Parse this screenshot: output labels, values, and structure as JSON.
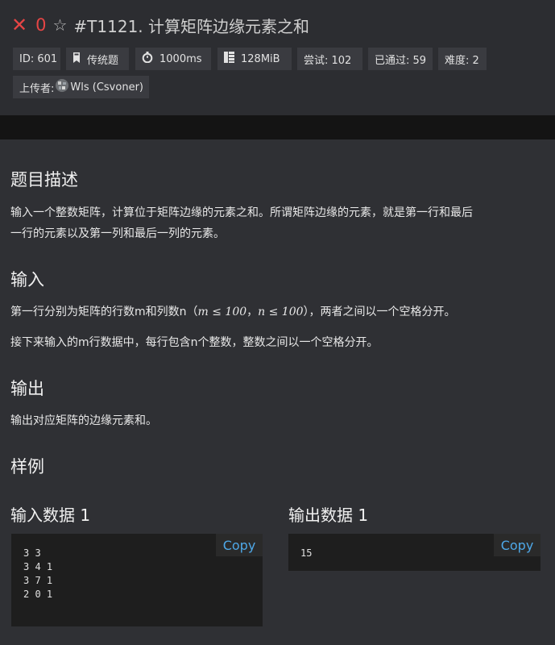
{
  "header": {
    "status_icon": "x-icon",
    "score": "0",
    "star_icon": "star-icon",
    "title": "#T1121. 计算矩阵边缘元素之和",
    "tags": {
      "id": "ID: 601",
      "type": "传统题",
      "time": "1000ms",
      "memory": "128MiB",
      "tries": "尝试: 102",
      "passed": "已通过: 59",
      "difficulty": "难度: 2",
      "uploader_label": "上传者:",
      "uploader_name": "Wls (Csvoner)"
    }
  },
  "sections": {
    "description_title": "题目描述",
    "description_line1": "输入一个整数矩阵，计算位于矩阵边缘的元素之和。所谓矩阵边缘的元素，就是第一行和最后",
    "description_line2": "一行的元素以及第一列和最后一列的元素。",
    "input_title": "输入",
    "input_p1_a": "第一行分别为矩阵的行数m和列数n（",
    "input_p1_math1": "m ≤ 100",
    "input_p1_sep": "，",
    "input_p1_math2": "n ≤ 100",
    "input_p1_b": "），两者之间以一个空格分开。",
    "input_p2": "接下来输入的m行数据中，每行包含n个整数，整数之间以一个空格分开。",
    "output_title": "输出",
    "output_p": "输出对应矩阵的边缘元素和。",
    "sample_title": "样例"
  },
  "samples": {
    "input_title": "输入数据 1",
    "input_code": "3 3\n3 4 1\n3 7 1\n2 0 1",
    "output_title": "输出数据 1",
    "output_code": "15",
    "copy_label": "Copy"
  },
  "colors": {
    "accent_red": "#e64545",
    "copy_blue": "#4ea8e8"
  }
}
